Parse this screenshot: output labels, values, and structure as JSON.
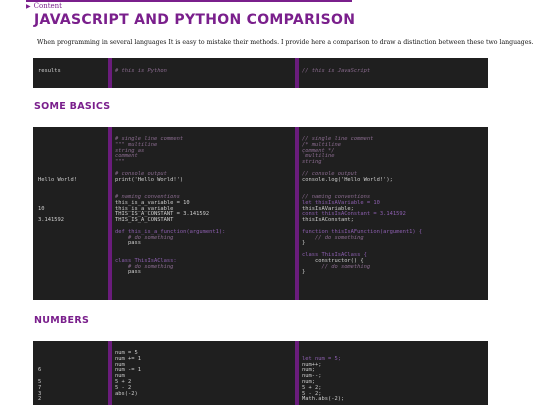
{
  "toc": {
    "arrow": "▶",
    "label": "Content"
  },
  "title": "JAVASCRIPT AND PYTHON COMPARISON",
  "intro": "When programming in several languages It is easy to mistake their methods. I provide here a comparison to draw a distinction between these two languages.",
  "header_row": {
    "col1": "results",
    "col2": "# this is Python",
    "col3": "// this is JavaScript"
  },
  "sections": {
    "basics": "SOME BASICS",
    "numbers": "NUMBERS"
  },
  "basics": {
    "results": [
      "",
      "",
      "",
      "",
      "",
      "",
      "",
      "Hello World!",
      "",
      "",
      "",
      "",
      "10",
      "",
      "3.141592"
    ],
    "python": [
      "# single line comment",
      "\"\"\" multiline",
      "string as",
      "comment",
      "\"\"\"",
      "",
      "# console output",
      "print('Hello World!')",
      "",
      "",
      "# naming conventions",
      "this_is_a_variable = 10",
      "this_is_a_variable",
      "THIS_IS_A_CONSTANT = 3.141592",
      "THIS_IS_A_CONSTANT",
      "",
      "def this_is_a_function(argument1):",
      "    # do something",
      "    pass",
      "",
      "",
      "class ThisIsAClass:",
      "    # do something",
      "    pass"
    ],
    "javascript": [
      "// single line comment",
      "/* multiline",
      "comment */",
      "`multiline",
      "string`",
      "",
      "// console output",
      "console.log('Hello World!');",
      "",
      "",
      "// naming conventions",
      "let thisIsAVariable = 10",
      "thisIsAVariable;",
      "const thisIsAConstant = 3.141592",
      "thisIsAConstant;",
      "",
      "function thisIsAFunction(argument1) {",
      "    // do something",
      "}",
      "",
      "class ThisIsAClass {",
      "    constructor() {",
      "      // do something",
      "}"
    ]
  },
  "numbers": {
    "results": [
      "",
      "",
      "",
      "6",
      "",
      "5",
      "7",
      "3",
      "2"
    ],
    "python": [
      "num = 5",
      "num += 1",
      "num",
      "num -= 1",
      "num",
      "5 + 2",
      "5 - 2",
      "abs(-2)"
    ],
    "javascript": [
      "",
      "let num = 5;",
      "num++;",
      "num;",
      "num--;",
      "num;",
      "5 + 2;",
      "5 - 2;",
      "Math.abs(-2);"
    ]
  },
  "colors": {
    "accent": "#7a1f8c",
    "code_bg": "#1f1f1f",
    "separator": "#6a1c7c"
  }
}
